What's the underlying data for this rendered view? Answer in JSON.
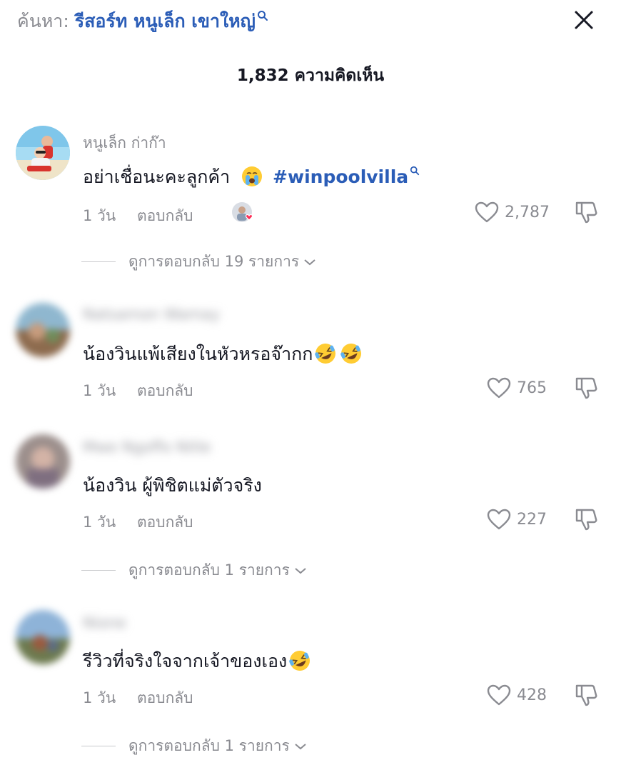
{
  "header": {
    "search_prefix": "ค้นหา:",
    "search_query": "รีสอร์ท หนูเล็ก เขาใหญ่",
    "comment_count_title": "1,832 ความคิดเห็น"
  },
  "comments": [
    {
      "username": "หนูเล็ก ก่าก๊า",
      "text": "อย่าเชื่อนะคะลูกค้า",
      "hashtag": "#winpoolvilla",
      "age": "1 วัน",
      "reply_label": "ตอบกลับ",
      "likes": "2,787",
      "view_replies": "ดูการตอบกลับ 19 รายการ"
    },
    {
      "username": "Natsamon Wamay",
      "text": "น้องวินแพ้เสียงในหัวหรอจ๊ากก",
      "age": "1 วัน",
      "reply_label": "ตอบกลับ",
      "likes": "765"
    },
    {
      "username": "Mwe Ngoffo Nitle",
      "text": "น้องวิน ผู้พิชิตแม่ตัวจริง",
      "age": "1 วัน",
      "reply_label": "ตอบกลับ",
      "likes": "227",
      "view_replies": "ดูการตอบกลับ 1 รายการ"
    },
    {
      "username": "Nione",
      "text": "รีวิวที่จริงใจจากเจ้าของเอง",
      "age": "1 วัน",
      "reply_label": "ตอบกลับ",
      "likes": "428",
      "view_replies": "ดูการตอบกลับ 1 รายการ"
    }
  ],
  "colors": {
    "link_blue": "#2b5db7",
    "secondary_text": "#8a8b91",
    "primary_text": "#161823"
  },
  "icons": [
    "search-icon",
    "close-icon",
    "heart-outline-icon",
    "dislike-icon",
    "chevron-down-icon",
    "crying-emoji",
    "rofl-emoji",
    "creator-liked-badge"
  ]
}
